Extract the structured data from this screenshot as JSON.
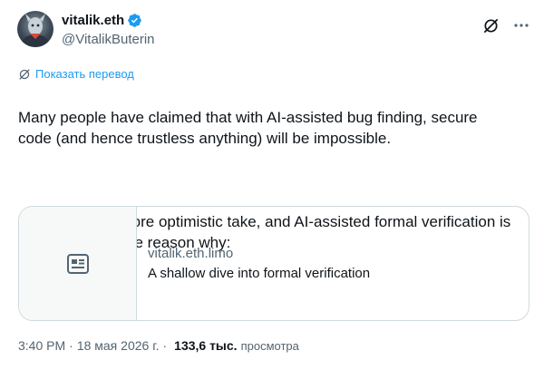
{
  "author": {
    "display_name": "vitalik.eth",
    "handle": "@VitalikButerin",
    "verified": true
  },
  "icons": {
    "verified": "verified-badge-icon",
    "grok": "grok-icon",
    "more": "more-icon",
    "translate": "translate-icon",
    "card": "article-icon"
  },
  "colors": {
    "accent": "#1d9bf0",
    "text": "#0f1419",
    "secondary": "#536471",
    "border": "#cfd9de"
  },
  "translate_label": "Показать перевод",
  "tweet": {
    "paragraph1": "Many people have claimed that with AI-assisted bug finding, secure\ncode (and hence trustless anything) will be impossible.",
    "paragraph2": "I have a much more optimistic take, and AI-assisted formal verification is\na major part of the reason why:"
  },
  "card": {
    "domain": "vitalik.eth.limo",
    "title": "A shallow dive into formal verification"
  },
  "meta": {
    "time": "3:40 PM",
    "separator": "·",
    "date": "18 мая 2026 г.",
    "views_count": "133,6 тыс.",
    "views_label": "просмотра"
  }
}
